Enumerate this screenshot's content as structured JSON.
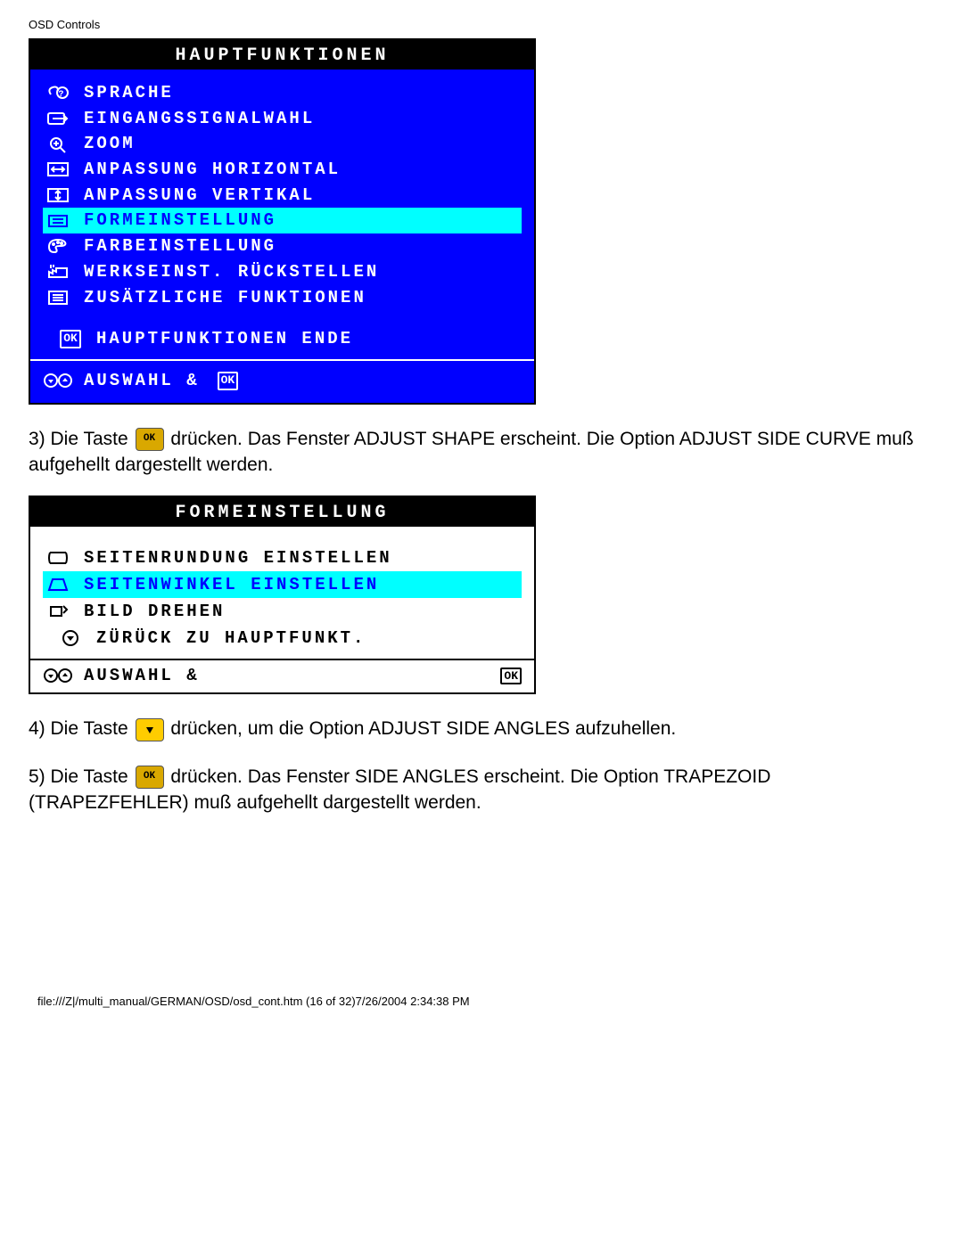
{
  "header": "OSD Controls",
  "osd1": {
    "title": "HAUPTFUNKTIONEN",
    "items": [
      {
        "label": "SPRACHE",
        "selected": false
      },
      {
        "label": "EINGANGSSIGNALWAHL",
        "selected": false
      },
      {
        "label": "ZOOM",
        "selected": false
      },
      {
        "label": "ANPASSUNG HORIZONTAL",
        "selected": false
      },
      {
        "label": "ANPASSUNG VERTIKAL",
        "selected": false
      },
      {
        "label": "FORMEINSTELLUNG",
        "selected": true
      },
      {
        "label": "FARBEINSTELLUNG",
        "selected": false
      },
      {
        "label": "WERKSEINST. RÜCKSTELLEN",
        "selected": false
      },
      {
        "label": "ZUSÄTZLICHE FUNKTIONEN",
        "selected": false
      }
    ],
    "end": "HAUPTFUNKTIONEN ENDE",
    "footer_left": "AUSWAHL &"
  },
  "step3a": "3) Die Taste ",
  "step3b": " drücken. Das Fenster ADJUST SHAPE erscheint. Die Option ADJUST SIDE CURVE muß aufgehellt dargestellt werden.",
  "osd2": {
    "title": "FORMEINSTELLUNG",
    "items": [
      {
        "label": "SEITENRUNDUNG EINSTELLEN",
        "selected": false
      },
      {
        "label": "SEITENWINKEL EINSTELLEN",
        "selected": true
      },
      {
        "label": "BILD DREHEN",
        "selected": false
      }
    ],
    "back": "ZÜRÜCK ZU HAUPTFUNKT.",
    "footer_left": "AUSWAHL &"
  },
  "step4a": "4) Die Taste ",
  "step4b": " drücken, um die Option ADJUST SIDE ANGLES aufzuhellen.",
  "step5a": "5) Die Taste ",
  "step5b": " drücken. Das Fenster SIDE ANGLES erscheint. Die Option TRAPEZOID (TRAPEZFEHLER) muß aufgehellt dargestellt werden.",
  "footer": "file:///Z|/multi_manual/GERMAN/OSD/osd_cont.htm (16 of 32)7/26/2004 2:34:38 PM"
}
